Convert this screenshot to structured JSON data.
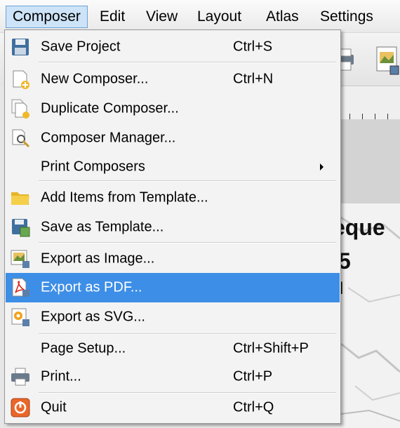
{
  "menubar": {
    "items": [
      {
        "label": "Composer"
      },
      {
        "label": "Edit"
      },
      {
        "label": "View"
      },
      {
        "label": "Layout"
      },
      {
        "label": "Atlas"
      },
      {
        "label": "Settings"
      }
    ]
  },
  "background": {
    "map_text_1": "eque",
    "map_text_2": "5",
    "map_text_3": "l"
  },
  "composer_menu": {
    "items": [
      {
        "label": "Save Project",
        "shortcut": "Ctrl+S",
        "icon": "save-icon"
      },
      {
        "label": "New Composer...",
        "shortcut": "Ctrl+N",
        "icon": "new-composer-icon"
      },
      {
        "label": "Duplicate Composer...",
        "shortcut": "",
        "icon": "duplicate-composer-icon"
      },
      {
        "label": "Composer Manager...",
        "shortcut": "",
        "icon": "composer-manager-icon"
      },
      {
        "label": "Print Composers",
        "shortcut": "",
        "icon": "",
        "submenu": true
      },
      {
        "label": "Add Items from Template...",
        "shortcut": "",
        "icon": "folder-icon"
      },
      {
        "label": "Save as Template...",
        "shortcut": "",
        "icon": "save-template-icon"
      },
      {
        "label": "Export as Image...",
        "shortcut": "",
        "icon": "export-image-icon"
      },
      {
        "label": "Export as PDF...",
        "shortcut": "",
        "icon": "pdf-icon",
        "highlighted": true
      },
      {
        "label": "Export as SVG...",
        "shortcut": "",
        "icon": "svg-icon"
      },
      {
        "label": "Page Setup...",
        "shortcut": "Ctrl+Shift+P",
        "icon": ""
      },
      {
        "label": "Print...",
        "shortcut": "Ctrl+P",
        "icon": "printer-icon"
      },
      {
        "label": "Quit",
        "shortcut": "Ctrl+Q",
        "icon": "quit-icon"
      }
    ]
  },
  "colors": {
    "highlight": "#3d8ee6",
    "menubar_active": "#cde3f8"
  }
}
